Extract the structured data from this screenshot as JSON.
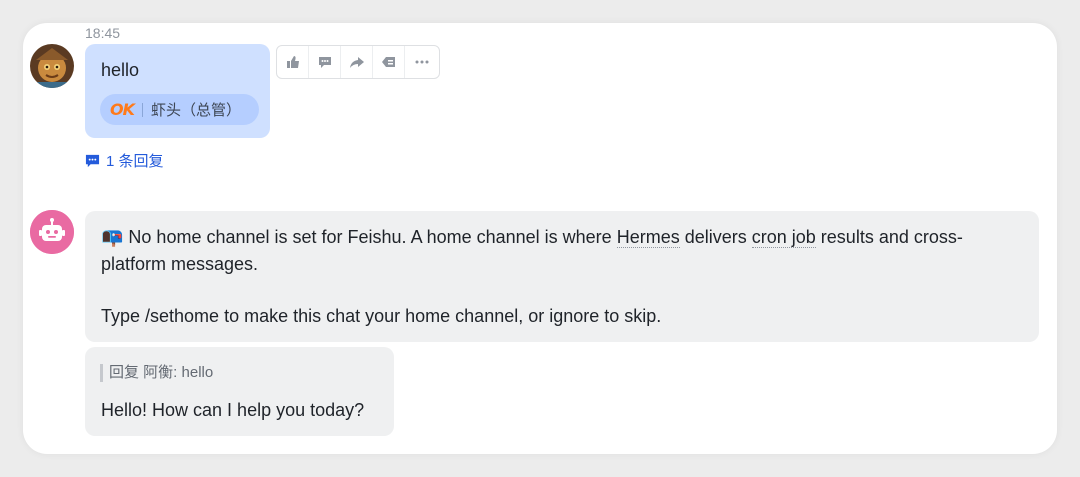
{
  "thread": {
    "timestamp": "18:45",
    "user_message": {
      "text": "hello",
      "reaction": {
        "emoji_text": "OK",
        "reactor": "虾头（总管）"
      },
      "reply_link": "1 条回复"
    },
    "toolbar": {
      "icons": [
        "thumbs-up-icon",
        "comment-icon",
        "forward-icon",
        "quote-icon",
        "more-icon"
      ]
    },
    "bot_message": {
      "emoji": "📭",
      "text_a": " No home channel is set for Feishu. A home channel is where ",
      "term_hermes": "Hermes",
      "text_b": " delivers ",
      "term_cron": "cron job",
      "text_c": " results and cross-platform messages.",
      "text_d": "Type /sethome to make this chat your home channel, or ignore to skip."
    },
    "bot_reply": {
      "quote_label": "回复 阿衡:",
      "quote_text": "hello",
      "text": "Hello! How can I help you today?"
    }
  },
  "colors": {
    "self_bubble": "#cfe0ff",
    "reaction_pill": "#b5ceff",
    "bot_bubble": "#eff0f1",
    "link_blue": "#245bdb",
    "bot_avatar": "#e96aa2",
    "ok_orange": "#ff7a1a"
  }
}
